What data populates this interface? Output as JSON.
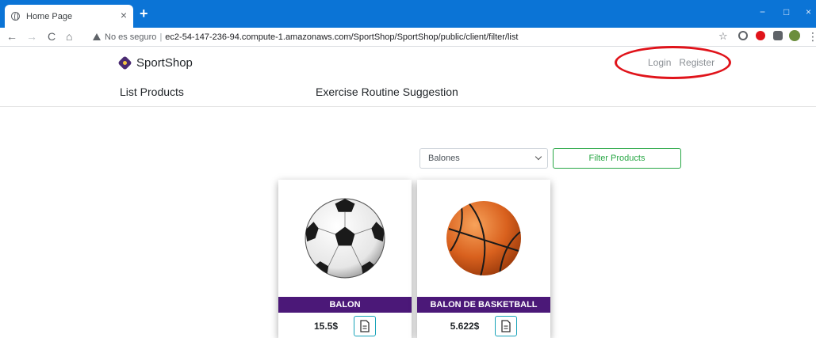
{
  "browser": {
    "tab_title": "Home Page",
    "tab_close": "×",
    "new_tab": "+",
    "minimize": "−",
    "maximize": "□",
    "close": "×",
    "back": "←",
    "forward": "→",
    "reload": "C",
    "home": "⌂",
    "insecure_label": "No es seguro",
    "separator": "|",
    "url": "ec2-54-147-236-94.compute-1.amazonaws.com/SportShop/SportShop/public/client/filter/list",
    "star": "☆",
    "menu": "⋮"
  },
  "header": {
    "brand": "SportShop",
    "login": "Login",
    "register": "Register"
  },
  "nav": {
    "list_products": "List Products",
    "exercise_routine": "Exercise Routine Suggestion"
  },
  "filter": {
    "selected": "Balones",
    "button": "Filter Products"
  },
  "products": [
    {
      "name": "BALON",
      "price": "15.5$"
    },
    {
      "name": "BALON DE BASKETBALL",
      "price": "5.622$"
    }
  ],
  "colors": {
    "tabbar": "#0b74d6",
    "product_banner": "#4b1878",
    "filter_green": "#28a745",
    "annotation_red": "#e0131a"
  }
}
